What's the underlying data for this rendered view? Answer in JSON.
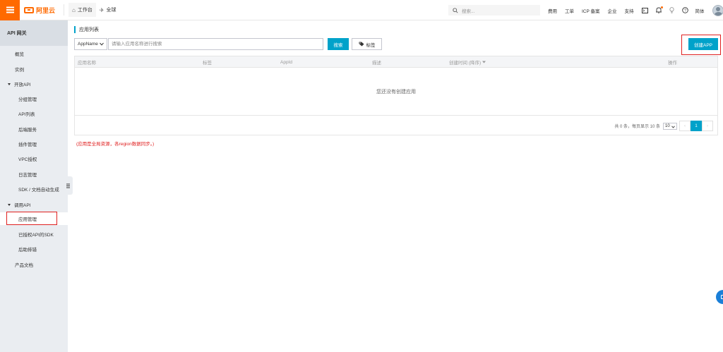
{
  "topbar": {
    "brand": "阿里云",
    "workbench": "工作台",
    "region": "全球",
    "search_placeholder": "搜索...",
    "links": [
      "费用",
      "工单",
      "ICP 备案",
      "企业",
      "支持"
    ],
    "language": "简体"
  },
  "sidebar": {
    "title": "API 网关",
    "items": [
      {
        "label": "概览"
      },
      {
        "label": "实例"
      },
      {
        "label": "开放API"
      },
      {
        "label": "分组管理"
      },
      {
        "label": "API列表"
      },
      {
        "label": "后端服务"
      },
      {
        "label": "插件管理"
      },
      {
        "label": "VPC授权"
      },
      {
        "label": "日志管理"
      },
      {
        "label": "SDK / 文档自动生成"
      },
      {
        "label": "调用API"
      },
      {
        "label": "应用管理"
      },
      {
        "label": "已授权API的SDK"
      },
      {
        "label": "后助排错"
      },
      {
        "label": "产品文档"
      }
    ]
  },
  "main": {
    "title": "应用列表",
    "create_button": "创建APP",
    "filter": {
      "select_value": "AppName",
      "placeholder": "请输入应用名称进行搜索",
      "search_button": "搜索",
      "tag_button": "标签"
    },
    "table": {
      "columns": [
        "应用名称",
        "标签",
        "AppId",
        "描述",
        "创建时间 (降序)",
        "操作"
      ],
      "empty_text": "您还没有创建应用"
    },
    "pagination": {
      "summary": "共 0 条，每页显示 10 条",
      "page_size": "10",
      "current_page": "1"
    },
    "note": "(应用是全局资源，各region数据同步。)"
  },
  "colors": {
    "brand_orange": "#ff6a00",
    "primary_blue": "#00a2ca",
    "highlight_red": "#e02020"
  }
}
